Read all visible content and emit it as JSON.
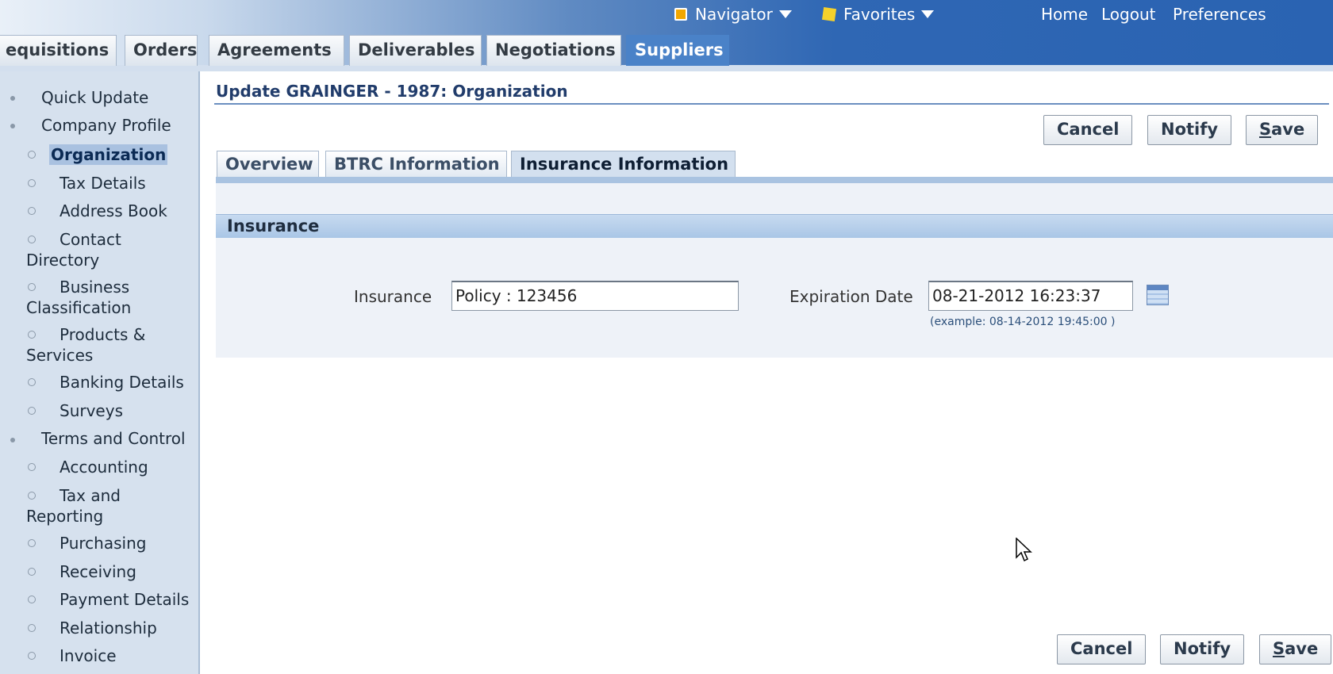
{
  "global_nav": {
    "navigator": "Navigator",
    "favorites": "Favorites",
    "home": "Home",
    "logout": "Logout",
    "preferences": "Preferences"
  },
  "main_tabs": [
    "equisitions",
    "Orders",
    "Agreements",
    "Deliverables",
    "Negotiations",
    "Suppliers"
  ],
  "sidebar": {
    "items": [
      {
        "label": "Quick Update",
        "level": 1
      },
      {
        "label": "Company Profile",
        "level": 1
      },
      {
        "label": "Organization",
        "level": 2,
        "selected": true
      },
      {
        "label": "Tax Details",
        "level": 2
      },
      {
        "label": "Address Book",
        "level": 2
      },
      {
        "label": "Contact",
        "label2": "Directory",
        "level": 2
      },
      {
        "label": "Business",
        "label2": "Classification",
        "level": 2
      },
      {
        "label": "Products &",
        "label2": "Services",
        "level": 2
      },
      {
        "label": "Banking Details",
        "level": 2
      },
      {
        "label": "Surveys",
        "level": 2
      },
      {
        "label": "Terms and Control",
        "level": 1
      },
      {
        "label": "Accounting",
        "level": 2
      },
      {
        "label": "Tax and",
        "label2": "Reporting",
        "level": 2
      },
      {
        "label": "Purchasing",
        "level": 2
      },
      {
        "label": "Receiving",
        "level": 2
      },
      {
        "label": "Payment Details",
        "level": 2
      },
      {
        "label": "Relationship",
        "level": 2
      },
      {
        "label": "Invoice",
        "level": 2
      }
    ]
  },
  "page": {
    "title": "Update GRAINGER - 1987: Organization",
    "buttons": {
      "cancel": "Cancel",
      "notify": "Notify",
      "save_prefix": "S",
      "save_rest": "ave"
    },
    "subtabs": [
      "Overview",
      "BTRC Information",
      "Insurance Information"
    ],
    "active_subtab": "Insurance Information"
  },
  "insurance": {
    "header": "Insurance",
    "insurance_label": "Insurance",
    "insurance_value": "Policy : 123456",
    "expiration_label": "Expiration Date",
    "expiration_value": "08-21-2012 16:23:37",
    "expiration_hint": "(example: 08-14-2012 19:45:00 )"
  },
  "colors": {
    "banner_accent": "#2a63b2",
    "active_tab": "#4a82c8",
    "sidebar_bg": "#d6e1ee",
    "title_color": "#213c6b"
  }
}
